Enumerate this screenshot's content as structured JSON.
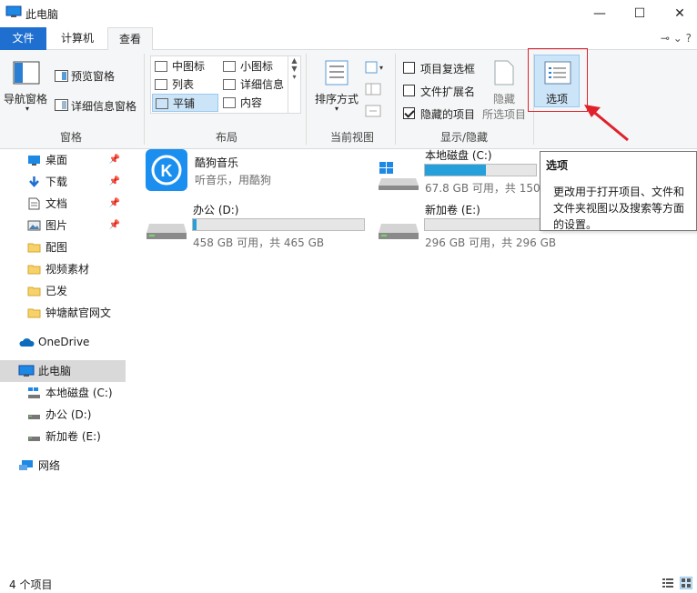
{
  "window": {
    "title": "此电脑",
    "minimize": "—",
    "maximize": "☐",
    "close": "✕"
  },
  "tabs": {
    "file": "文件",
    "computer": "计算机",
    "view": "查看",
    "right_controls": "⊸  ⌄  ?"
  },
  "ribbon": {
    "pane_group": {
      "label": "窗格",
      "nav_pane": "导航窗格",
      "preview_pane": "预览窗格",
      "details_pane": "详细信息窗格"
    },
    "layout_group": {
      "label": "布局",
      "items": [
        "中图标",
        "小图标",
        "列表",
        "详细信息",
        "平铺",
        "内容"
      ]
    },
    "current_view_group": {
      "label": "当前视图",
      "sort_by": "排序方式"
    },
    "show_hide_group": {
      "label": "显示/隐藏",
      "item_checkboxes": "项目复选框",
      "file_extensions": "文件扩展名",
      "hidden_items": "隐藏的项目",
      "hide_selected_line1": "隐藏",
      "hide_selected_line2": "所选项目"
    },
    "options": "选项"
  },
  "tooltip": {
    "title": "选项",
    "body": "更改用于打开项目、文件和文件夹视图以及搜索等方面的设置。"
  },
  "nav": {
    "items": [
      {
        "label": "桌面"
      },
      {
        "label": "下载"
      },
      {
        "label": "文档"
      },
      {
        "label": "图片"
      },
      {
        "label": "配图"
      },
      {
        "label": "视频素材"
      },
      {
        "label": "已发"
      },
      {
        "label": "钟塘献官网文"
      },
      {
        "label": "OneDrive"
      },
      {
        "label": "此电脑"
      },
      {
        "label": "本地磁盘 (C:)"
      },
      {
        "label": "办公 (D:)"
      },
      {
        "label": "新加卷 (E:)"
      },
      {
        "label": "网络"
      }
    ]
  },
  "content": {
    "app": {
      "name": "酷狗音乐",
      "sub": "听音乐，用酷狗"
    },
    "drives": [
      {
        "name": "本地磁盘 (C:)",
        "free": "67.8 GB 可用，共 150",
        "used_fraction": 0.55
      },
      {
        "name": "办公 (D:)",
        "free": "458 GB 可用，共 465 GB",
        "used_fraction": 0.02
      },
      {
        "name": "新加卷 (E:)",
        "free": "296 GB 可用，共 296 GB",
        "used_fraction": 0.0
      }
    ]
  },
  "status": {
    "count": "4 个项目"
  },
  "colors": {
    "accent": "#1f6fd1",
    "drive_fill": "#26a0da",
    "highlight": "#e0212b"
  }
}
